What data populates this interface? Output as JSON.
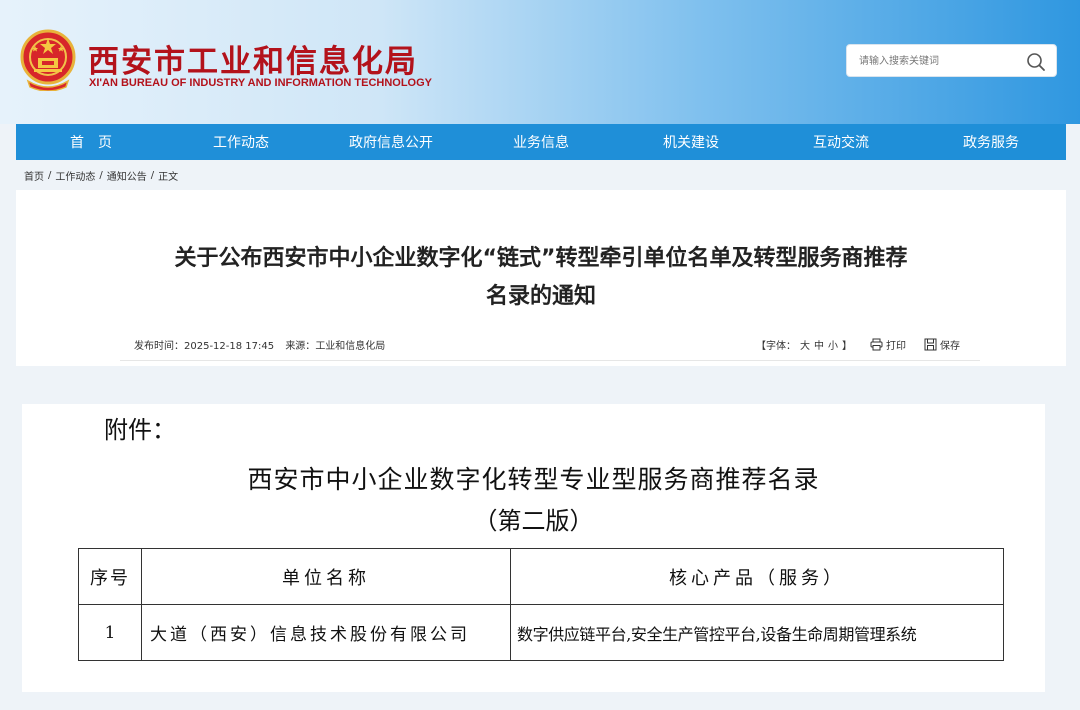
{
  "header": {
    "site_title": "西安市工业和信息化局",
    "site_subtitle": "XI'AN BUREAU OF INDUSTRY AND INFORMATION TECHNOLOGY",
    "emblem": "national-emblem-icon",
    "search": {
      "placeholder": "请输入搜索关键词",
      "icon": "search-icon"
    }
  },
  "nav": {
    "items": [
      {
        "label": "首　页"
      },
      {
        "label": "工作动态"
      },
      {
        "label": "政府信息公开"
      },
      {
        "label": "业务信息"
      },
      {
        "label": "机关建设"
      },
      {
        "label": "互动交流"
      },
      {
        "label": "政务服务"
      }
    ]
  },
  "breadcrumb": [
    "首页",
    "工作动态",
    "通知公告",
    "正文"
  ],
  "article": {
    "title_line1": "关于公布西安市中小企业数字化“链式”转型牵引单位名单及转型服务商推荐",
    "title_line2": "名录的通知",
    "publish_label": "发布时间：",
    "publish_time": "2025-12-18 17:45",
    "source_label": "来源：",
    "source": "工业和信息化局",
    "font_size_prefix": "【字体：",
    "font_large": "大",
    "font_medium": "中",
    "font_small": "小",
    "font_size_suffix": "】",
    "print_label": "打印",
    "save_label": "保存"
  },
  "attachment": {
    "label": "附件：",
    "title": "西安市中小企业数字化转型专业型服务商推荐名录",
    "subtitle": "（第二版）",
    "table": {
      "headers": [
        "序号",
        "单位名称",
        "核心产品（服务）"
      ],
      "rows": [
        {
          "seq": "1",
          "name": "大道（西安）信息技术股份有限公司",
          "product": "数字供应链平台,安全生产管控平台,设备生命周期管理系统"
        }
      ]
    }
  },
  "colors": {
    "brand_red": "#b3121b",
    "nav_blue": "#1f8fd8"
  }
}
